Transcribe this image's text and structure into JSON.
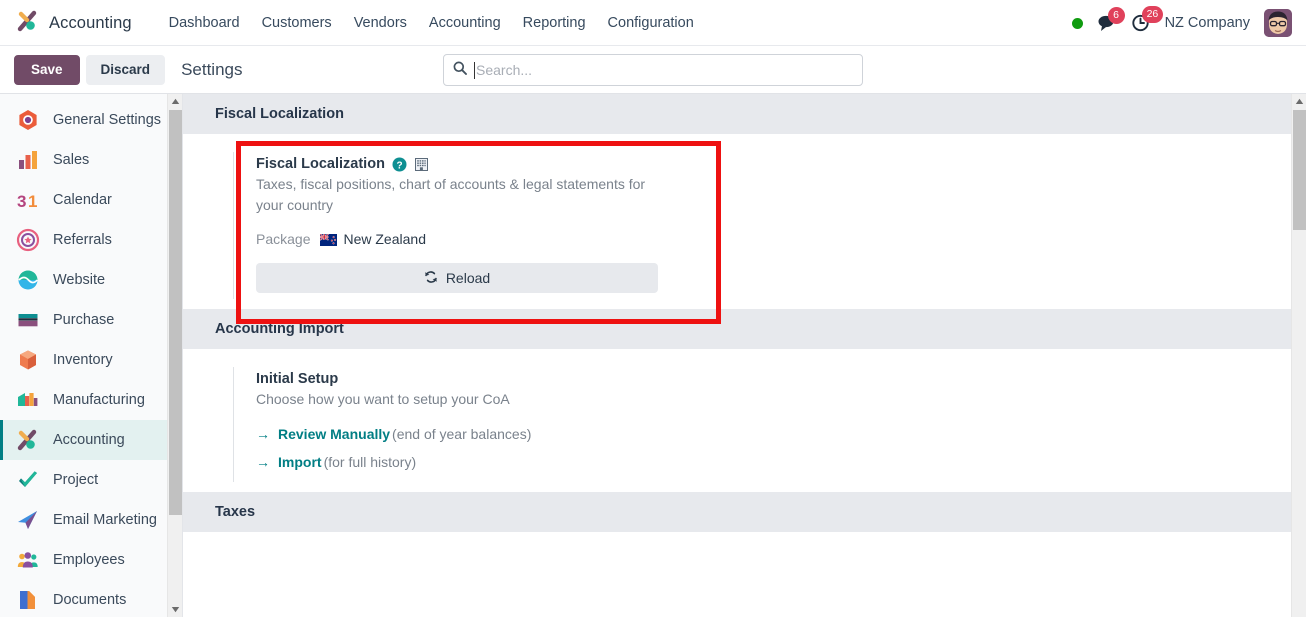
{
  "navbar": {
    "brand": "Accounting",
    "brand_icon": "accounting-app-icon",
    "menu": [
      {
        "label": "Dashboard"
      },
      {
        "label": "Customers"
      },
      {
        "label": "Vendors"
      },
      {
        "label": "Accounting"
      },
      {
        "label": "Reporting"
      },
      {
        "label": "Configuration"
      }
    ],
    "systray": {
      "status_dot": "online-status-dot",
      "messages_icon": "messages-icon",
      "messages_count": "6",
      "activities_icon": "activities-clock-icon",
      "activities_count": "26",
      "company": "NZ Company",
      "avatar": "user-avatar"
    },
    "colors": {
      "badge": "#e0415b",
      "online": "#0f9b0f"
    }
  },
  "control_panel": {
    "save_label": "Save",
    "discard_label": "Discard",
    "title": "Settings",
    "save_color": "#714b67"
  },
  "search": {
    "placeholder": "Search...",
    "value": "",
    "icon": "search-icon"
  },
  "sidebar": {
    "items": [
      {
        "label": "General Settings",
        "icon": "general-settings-icon",
        "active": false
      },
      {
        "label": "Sales",
        "icon": "sales-icon",
        "active": false
      },
      {
        "label": "Calendar",
        "icon": "calendar-icon",
        "active": false
      },
      {
        "label": "Referrals",
        "icon": "referrals-icon",
        "active": false
      },
      {
        "label": "Website",
        "icon": "website-icon",
        "active": false
      },
      {
        "label": "Purchase",
        "icon": "purchase-icon",
        "active": false
      },
      {
        "label": "Inventory",
        "icon": "inventory-icon",
        "active": false
      },
      {
        "label": "Manufacturing",
        "icon": "manufacturing-icon",
        "active": false
      },
      {
        "label": "Accounting",
        "icon": "accounting-icon",
        "active": true
      },
      {
        "label": "Project",
        "icon": "project-icon",
        "active": false
      },
      {
        "label": "Email Marketing",
        "icon": "email-marketing-icon",
        "active": false
      },
      {
        "label": "Employees",
        "icon": "employees-icon",
        "active": false
      },
      {
        "label": "Documents",
        "icon": "documents-icon",
        "active": false
      }
    ],
    "active_color": "#017e84",
    "active_bg": "#e3f1f0"
  },
  "main": {
    "sections": [
      {
        "heading": "Fiscal Localization",
        "setting": {
          "title": "Fiscal Localization",
          "help_icon": "help-question-icon",
          "company_icon": "company-building-icon",
          "description": "Taxes, fiscal positions, chart of accounts & legal statements for your country",
          "package_label": "Package",
          "package_value": "New Zealand",
          "package_flag": "new-zealand-flag-icon",
          "reload_label": "Reload",
          "reload_icon": "refresh-icon"
        },
        "highlighted": true
      },
      {
        "heading": "Accounting Import",
        "setting": {
          "title": "Initial Setup",
          "description": "Choose how you want to setup your CoA",
          "links": [
            {
              "arrow": "→",
              "label": "Review Manually",
              "note": "(end of year balances)"
            },
            {
              "arrow": "→",
              "label": "Import",
              "note": "(for full history)"
            }
          ]
        },
        "highlighted": false
      },
      {
        "heading": "Taxes",
        "highlighted": false
      }
    ],
    "highlight_color": "#ee1111"
  }
}
